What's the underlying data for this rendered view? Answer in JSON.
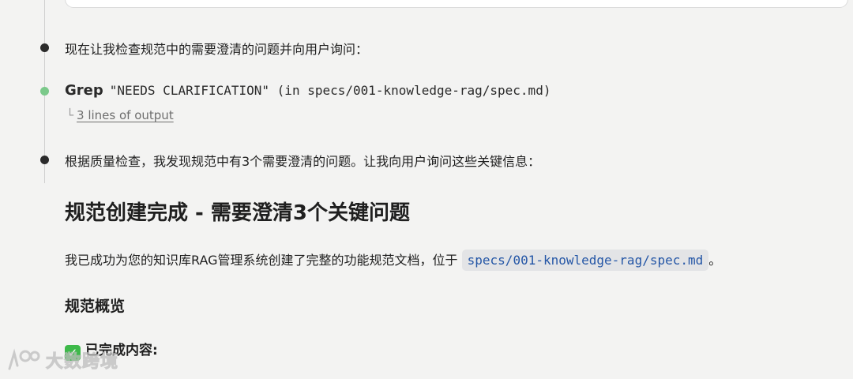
{
  "messages": [
    {
      "text": "现在让我检查规范中的需要澄清的问题并向用户询问："
    },
    {
      "text": "根据质量检查，我发现规范中有3个需要澄清的问题。让我向用户询问这些关键信息："
    }
  ],
  "tool_call": {
    "name": "Grep",
    "args": "\"NEEDS CLARIFICATION\" (in specs/001-knowledge-rag/spec.md)",
    "output_link": "3 lines of output"
  },
  "content": {
    "heading": "规范创建完成 - 需要澄清3个关键问题",
    "para_prefix": "我已成功为您的知识库RAG管理系统创建了完整的功能规范文档，位于",
    "para_code": "specs/001-knowledge-rag/spec.md",
    "para_suffix": "。",
    "subheading": "规范概览",
    "done_label": "已完成内容:"
  },
  "icons": {
    "timeline_dot": "bullet-dot",
    "tool_dot": "status-dot-green",
    "check": "check-mark-icon",
    "tree_corner": "tree-corner-icon"
  },
  "colors": {
    "background": "#f3f3f2",
    "tool_dot": "#7bc98a",
    "code_text": "#2456a6",
    "check_green": "#3db94a"
  },
  "watermark": {
    "text": "大数跨境"
  }
}
